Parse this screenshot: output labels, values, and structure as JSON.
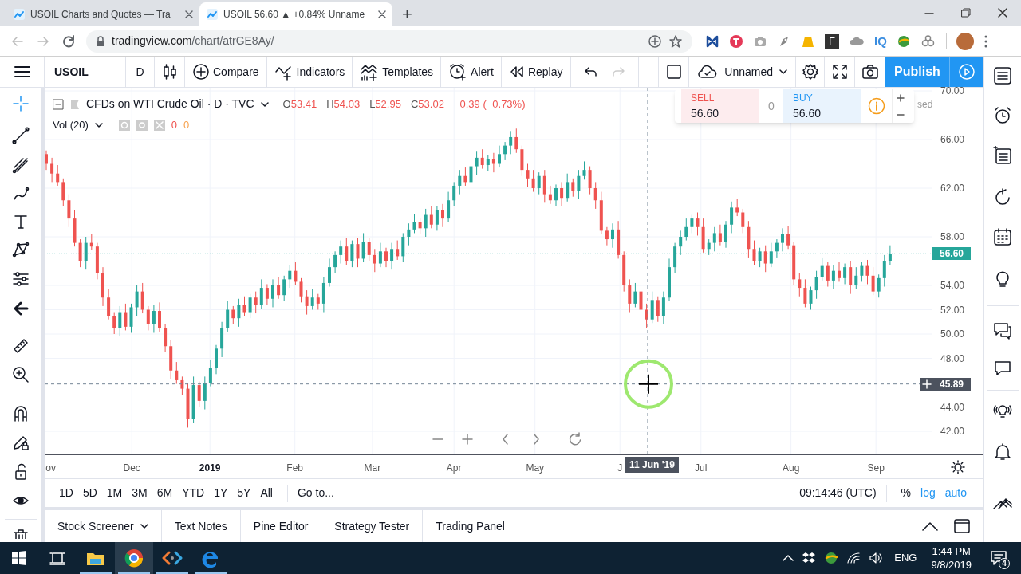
{
  "browser": {
    "tabs": [
      {
        "title": "USOIL Charts and Quotes — Tra",
        "selected": false
      },
      {
        "title": "USOIL 56.60 ▲ +0.84% Unname",
        "selected": true
      }
    ],
    "new_tab": "+",
    "url": {
      "host": "tradingview.com",
      "path": "/chart/atrGE8Ay/"
    },
    "extension_labels": [
      "F",
      "IQ"
    ]
  },
  "toolbar": {
    "symbol": "USOIL",
    "interval": "D",
    "items": [
      {
        "kind": "compare",
        "label": "Compare"
      },
      {
        "kind": "indicators",
        "label": "Indicators"
      },
      {
        "kind": "templates",
        "label": "Templates"
      },
      {
        "kind": "alert",
        "label": "Alert"
      },
      {
        "kind": "replay",
        "label": "Replay"
      }
    ],
    "layout_name": "Unnamed",
    "publish": "Publish"
  },
  "legend": {
    "title": "CFDs on WTI Crude Oil · D · TVC",
    "ohlc": [
      {
        "key": "O",
        "value": "53.41"
      },
      {
        "key": "H",
        "value": "54.03"
      },
      {
        "key": "L",
        "value": "52.95"
      },
      {
        "key": "C",
        "value": "53.02"
      }
    ],
    "change": "−0.39 (−0.73%)",
    "volume": {
      "label": "Vol (20)",
      "values": [
        {
          "text": "0",
          "color": "#ef5350"
        },
        {
          "text": "0",
          "color": "#f7a350"
        }
      ]
    }
  },
  "trade_widget": {
    "sell": {
      "label": "SELL",
      "price": "56.60"
    },
    "spread": "0",
    "buy": {
      "label": "BUY",
      "price": "56.60"
    }
  },
  "market_status": "sed",
  "chart": {
    "chart_data": {
      "type": "candlestick",
      "ylim": [
        42,
        70
      ],
      "grid": true,
      "ref_lines": [
        {
          "axis": "y",
          "value": 56.6,
          "label": "56.60",
          "color": "#26a69a"
        },
        {
          "axis": "y",
          "value": 45.89,
          "label": "45.89",
          "color": "#758696"
        }
      ],
      "yticks": [
        {
          "value": 70,
          "label": "70.00"
        },
        {
          "value": 66,
          "label": "66.00"
        },
        {
          "value": 62,
          "label": "62.00"
        },
        {
          "value": 58,
          "label": "58.00"
        },
        {
          "value": 54,
          "label": "54.00"
        },
        {
          "value": 52,
          "label": "52.00"
        },
        {
          "value": 50,
          "label": "50.00"
        },
        {
          "value": 48,
          "label": "48.00"
        },
        {
          "value": 44,
          "label": "44.00"
        },
        {
          "value": 42,
          "label": "42.00"
        }
      ],
      "categories": [
        null,
        null,
        null,
        null,
        null,
        null,
        null,
        null,
        null,
        null,
        null,
        null,
        null,
        null,
        null,
        null,
        null,
        null,
        null,
        null,
        null,
        null,
        null,
        null,
        null,
        null,
        null,
        null,
        null,
        null,
        null,
        null,
        null,
        null,
        null,
        null,
        null,
        null,
        null,
        null,
        null,
        null,
        null,
        null,
        null,
        null,
        null,
        null,
        null,
        null,
        null,
        null,
        null,
        null,
        null,
        null,
        null,
        null,
        null,
        null,
        null,
        null,
        null,
        null,
        null,
        null,
        null,
        null,
        null,
        null,
        null,
        null,
        null,
        null,
        null,
        null,
        null,
        null,
        null,
        null,
        null,
        null,
        null,
        null,
        null,
        null,
        null,
        null,
        null,
        null,
        null,
        null,
        null,
        null,
        null,
        null,
        null,
        null,
        null,
        null,
        null,
        null,
        null,
        null,
        null,
        null,
        null,
        null,
        null,
        null,
        null,
        null,
        null,
        null,
        null,
        null,
        null,
        null,
        null,
        null,
        null,
        null,
        null,
        null,
        null,
        null,
        null,
        null,
        null,
        null,
        null,
        null,
        null,
        null,
        null,
        null,
        null,
        null,
        null,
        null,
        null,
        null,
        null,
        null,
        null,
        null,
        null,
        null,
        null,
        null
      ],
      "ohlc": [
        [
          64.8,
          65.1,
          63.5,
          64.0
        ],
        [
          64.0,
          64.5,
          62.5,
          63.2
        ],
        [
          63.2,
          63.9,
          62.2,
          62.5
        ],
        [
          62.5,
          62.8,
          60.5,
          61.0
        ],
        [
          61.0,
          61.5,
          58.8,
          59.5
        ],
        [
          59.5,
          60.2,
          57.2,
          57.5
        ],
        [
          57.5,
          57.8,
          55.5,
          56.0
        ],
        [
          56.0,
          58.0,
          55.3,
          57.5
        ],
        [
          57.5,
          58.2,
          56.9,
          57.2
        ],
        [
          57.2,
          57.5,
          54.5,
          55.0
        ],
        [
          55.0,
          55.5,
          52.3,
          53.0
        ],
        [
          53.0,
          53.7,
          51.2,
          51.5
        ],
        [
          51.5,
          51.8,
          50.0,
          50.5
        ],
        [
          50.5,
          52.3,
          49.8,
          51.8
        ],
        [
          51.8,
          52.5,
          50.3,
          50.6
        ],
        [
          50.6,
          52.5,
          50.1,
          52.2
        ],
        [
          52.2,
          54.0,
          51.5,
          53.5
        ],
        [
          53.5,
          54.2,
          51.7,
          52.0
        ],
        [
          52.0,
          52.3,
          50.3,
          50.8
        ],
        [
          50.8,
          52.4,
          50.1,
          51.9
        ],
        [
          51.9,
          52.6,
          50.2,
          50.5
        ],
        [
          50.5,
          50.8,
          48.5,
          49.0
        ],
        [
          49.0,
          49.5,
          46.3,
          47.0
        ],
        [
          47.0,
          47.7,
          45.9,
          46.2
        ],
        [
          46.2,
          46.5,
          45.0,
          45.5
        ],
        [
          45.5,
          46.0,
          42.3,
          43.0
        ],
        [
          43.0,
          46.5,
          42.7,
          45.8
        ],
        [
          45.8,
          46.1,
          44.0,
          44.5
        ],
        [
          44.5,
          46.5,
          43.8,
          46.0
        ],
        [
          46.0,
          47.9,
          45.7,
          47.2
        ],
        [
          47.2,
          49.1,
          46.7,
          48.8
        ],
        [
          48.8,
          51.0,
          48.1,
          50.5
        ],
        [
          50.5,
          52.7,
          50.2,
          52.0
        ],
        [
          52.0,
          52.3,
          50.8,
          51.3
        ],
        [
          51.3,
          52.9,
          50.6,
          52.4
        ],
        [
          52.4,
          53.1,
          51.5,
          51.8
        ],
        [
          51.8,
          53.3,
          51.3,
          53.0
        ],
        [
          53.0,
          53.5,
          51.7,
          52.4
        ],
        [
          52.4,
          54.5,
          52.1,
          53.8
        ],
        [
          53.8,
          54.1,
          52.4,
          52.9
        ],
        [
          52.9,
          54.5,
          52.2,
          54.0
        ],
        [
          54.0,
          54.7,
          52.9,
          53.2
        ],
        [
          53.2,
          54.8,
          52.7,
          54.5
        ],
        [
          54.5,
          55.7,
          53.8,
          55.2
        ],
        [
          55.2,
          55.9,
          54.0,
          54.3
        ],
        [
          54.3,
          54.6,
          52.6,
          53.1
        ],
        [
          53.1,
          53.6,
          51.6,
          52.3
        ],
        [
          52.3,
          53.7,
          52.0,
          53.0
        ],
        [
          53.0,
          53.3,
          52.0,
          52.5
        ],
        [
          52.5,
          54.7,
          51.8,
          54.2
        ],
        [
          54.2,
          56.2,
          53.9,
          55.5
        ],
        [
          55.5,
          56.8,
          55.0,
          56.5
        ],
        [
          56.5,
          57.7,
          55.8,
          57.2
        ],
        [
          57.2,
          57.9,
          55.7,
          56.0
        ],
        [
          56.0,
          57.7,
          55.5,
          57.4
        ],
        [
          57.4,
          57.9,
          55.5,
          56.2
        ],
        [
          56.2,
          58.3,
          55.9,
          57.6
        ],
        [
          57.6,
          57.9,
          56.0,
          56.5
        ],
        [
          56.5,
          57.0,
          55.1,
          55.8
        ],
        [
          55.8,
          57.5,
          55.5,
          56.8
        ],
        [
          56.8,
          57.1,
          55.5,
          56.0
        ],
        [
          56.0,
          57.5,
          55.3,
          57.0
        ],
        [
          57.0,
          57.7,
          56.1,
          56.4
        ],
        [
          56.4,
          58.3,
          55.9,
          58.0
        ],
        [
          58.0,
          59.1,
          57.3,
          58.6
        ],
        [
          58.6,
          59.9,
          58.3,
          59.2
        ],
        [
          59.2,
          59.5,
          58.2,
          58.7
        ],
        [
          58.7,
          60.3,
          58.0,
          59.8
        ],
        [
          59.8,
          60.5,
          58.7,
          59.0
        ],
        [
          59.0,
          60.5,
          58.5,
          60.2
        ],
        [
          60.2,
          60.7,
          58.8,
          59.5
        ],
        [
          59.5,
          61.7,
          59.2,
          61.0
        ],
        [
          61.0,
          62.5,
          60.5,
          62.2
        ],
        [
          62.2,
          63.5,
          61.5,
          63.0
        ],
        [
          63.0,
          63.7,
          62.2,
          62.5
        ],
        [
          62.5,
          64.1,
          62.0,
          63.8
        ],
        [
          63.8,
          65.0,
          63.1,
          64.5
        ],
        [
          64.5,
          65.2,
          63.6,
          63.9
        ],
        [
          63.9,
          64.7,
          63.4,
          64.4
        ],
        [
          64.4,
          64.9,
          63.3,
          64.0
        ],
        [
          64.0,
          65.5,
          63.7,
          64.8
        ],
        [
          64.8,
          65.8,
          64.3,
          65.5
        ],
        [
          65.5,
          66.7,
          64.8,
          66.2
        ],
        [
          66.2,
          66.9,
          64.9,
          65.2
        ],
        [
          65.2,
          65.5,
          63.0,
          63.5
        ],
        [
          63.5,
          64.0,
          62.1,
          62.8
        ],
        [
          62.8,
          63.5,
          61.7,
          62.0
        ],
        [
          62.0,
          63.3,
          61.5,
          63.0
        ],
        [
          63.0,
          63.5,
          60.8,
          61.5
        ],
        [
          61.5,
          62.2,
          60.7,
          61.0
        ],
        [
          61.0,
          62.3,
          60.5,
          62.0
        ],
        [
          62.0,
          62.5,
          60.5,
          61.2
        ],
        [
          61.2,
          63.2,
          60.9,
          62.5
        ],
        [
          62.5,
          62.8,
          61.3,
          61.8
        ],
        [
          61.8,
          63.5,
          61.1,
          63.0
        ],
        [
          63.0,
          64.2,
          62.7,
          63.5
        ],
        [
          63.5,
          63.8,
          61.5,
          62.0
        ],
        [
          62.0,
          62.5,
          60.3,
          61.0
        ],
        [
          61.0,
          61.7,
          58.2,
          58.5
        ],
        [
          58.5,
          58.8,
          57.3,
          57.8
        ],
        [
          57.8,
          59.1,
          57.1,
          58.6
        ],
        [
          58.6,
          59.3,
          56.2,
          56.5
        ],
        [
          56.5,
          56.8,
          53.5,
          54.0
        ],
        [
          54.0,
          54.5,
          51.8,
          52.5
        ],
        [
          52.5,
          54.2,
          52.2,
          53.5
        ],
        [
          53.5,
          53.8,
          51.5,
          52.0
        ],
        [
          52.0,
          52.5,
          50.5,
          51.2
        ],
        [
          51.2,
          53.5,
          50.9,
          52.8
        ],
        [
          52.8,
          53.1,
          51.0,
          51.5
        ],
        [
          51.5,
          53.5,
          50.8,
          53.0
        ],
        [
          53.0,
          56.2,
          52.7,
          55.5
        ],
        [
          55.5,
          57.5,
          55.0,
          57.2
        ],
        [
          57.2,
          58.5,
          56.5,
          58.0
        ],
        [
          58.0,
          59.5,
          57.7,
          58.8
        ],
        [
          58.8,
          59.8,
          58.3,
          59.5
        ],
        [
          59.5,
          60.0,
          58.1,
          58.8
        ],
        [
          58.8,
          59.5,
          56.7,
          57.0
        ],
        [
          57.0,
          57.8,
          56.5,
          57.5
        ],
        [
          57.5,
          58.8,
          56.8,
          58.3
        ],
        [
          58.3,
          59.0,
          57.3,
          57.6
        ],
        [
          57.6,
          59.3,
          57.1,
          59.0
        ],
        [
          59.0,
          60.9,
          58.3,
          60.4
        ],
        [
          60.4,
          61.1,
          59.7,
          60.0
        ],
        [
          60.0,
          60.3,
          58.3,
          58.8
        ],
        [
          58.8,
          59.3,
          56.3,
          57.0
        ],
        [
          57.0,
          57.7,
          55.7,
          56.0
        ],
        [
          56.0,
          57.1,
          55.5,
          56.8
        ],
        [
          56.8,
          57.3,
          55.1,
          55.8
        ],
        [
          55.8,
          57.5,
          55.5,
          56.8
        ],
        [
          56.8,
          57.8,
          56.3,
          57.5
        ],
        [
          57.5,
          58.7,
          56.8,
          58.2
        ],
        [
          58.2,
          58.9,
          57.0,
          57.3
        ],
        [
          57.3,
          57.6,
          54.0,
          54.5
        ],
        [
          54.5,
          55.0,
          53.1,
          53.8
        ],
        [
          53.8,
          54.5,
          52.2,
          52.5
        ],
        [
          52.5,
          53.9,
          52.0,
          53.6
        ],
        [
          53.6,
          55.2,
          52.9,
          54.7
        ],
        [
          54.7,
          56.3,
          54.4,
          55.6
        ],
        [
          55.6,
          55.9,
          53.9,
          54.4
        ],
        [
          54.4,
          55.7,
          53.7,
          55.2
        ],
        [
          55.2,
          55.9,
          54.3,
          54.6
        ],
        [
          54.6,
          55.8,
          54.1,
          55.5
        ],
        [
          55.5,
          56.0,
          53.3,
          54.0
        ],
        [
          54.0,
          55.5,
          53.7,
          54.8
        ],
        [
          54.8,
          55.9,
          54.3,
          55.6
        ],
        [
          55.6,
          56.1,
          54.1,
          54.8
        ],
        [
          54.8,
          55.5,
          53.2,
          53.5
        ],
        [
          53.5,
          54.9,
          53.0,
          54.6
        ],
        [
          54.6,
          56.5,
          53.9,
          56.0
        ],
        [
          56.0,
          57.3,
          55.7,
          56.6
        ]
      ]
    }
  },
  "time_axis": {
    "labels": [
      {
        "label": "ov",
        "bold": false
      },
      {
        "label": "Dec",
        "bold": false
      },
      {
        "label": "2019",
        "bold": true
      },
      {
        "label": "Feb",
        "bold": false
      },
      {
        "label": "Mar",
        "bold": false
      },
      {
        "label": "Apr",
        "bold": false
      },
      {
        "label": "May",
        "bold": false
      },
      {
        "label": "J",
        "bold": false
      },
      {
        "label": "Jul",
        "bold": false
      },
      {
        "label": "Aug",
        "bold": false
      },
      {
        "label": "Sep",
        "bold": false
      }
    ],
    "crosshair_date": "11 Jun '19"
  },
  "range_bar": {
    "ranges": [
      "1D",
      "5D",
      "1M",
      "3M",
      "6M",
      "YTD",
      "1Y",
      "5Y",
      "All"
    ],
    "goto": "Go to...",
    "clock": "09:14:46 (UTC)",
    "scale_options": [
      {
        "label": "%",
        "on": false
      },
      {
        "label": "log",
        "on": true
      },
      {
        "label": "auto",
        "on": true
      }
    ]
  },
  "bottom_panel": {
    "tabs": [
      {
        "label": "Stock Screener",
        "dropdown": true
      },
      {
        "label": "Text Notes",
        "dropdown": false
      },
      {
        "label": "Pine Editor",
        "dropdown": false
      },
      {
        "label": "Strategy Tester",
        "dropdown": false
      },
      {
        "label": "Trading Panel",
        "dropdown": false
      }
    ]
  },
  "taskbar": {
    "apps": [
      {
        "kind": "explorer",
        "running": true,
        "selected": false
      },
      {
        "kind": "chrome",
        "running": true,
        "selected": true
      },
      {
        "kind": "code",
        "running": true,
        "selected": false
      },
      {
        "kind": "edge",
        "running": true,
        "selected": false
      }
    ],
    "language": "ENG",
    "time": "1:44 PM",
    "date": "9/8/2019",
    "notifications": "4"
  }
}
